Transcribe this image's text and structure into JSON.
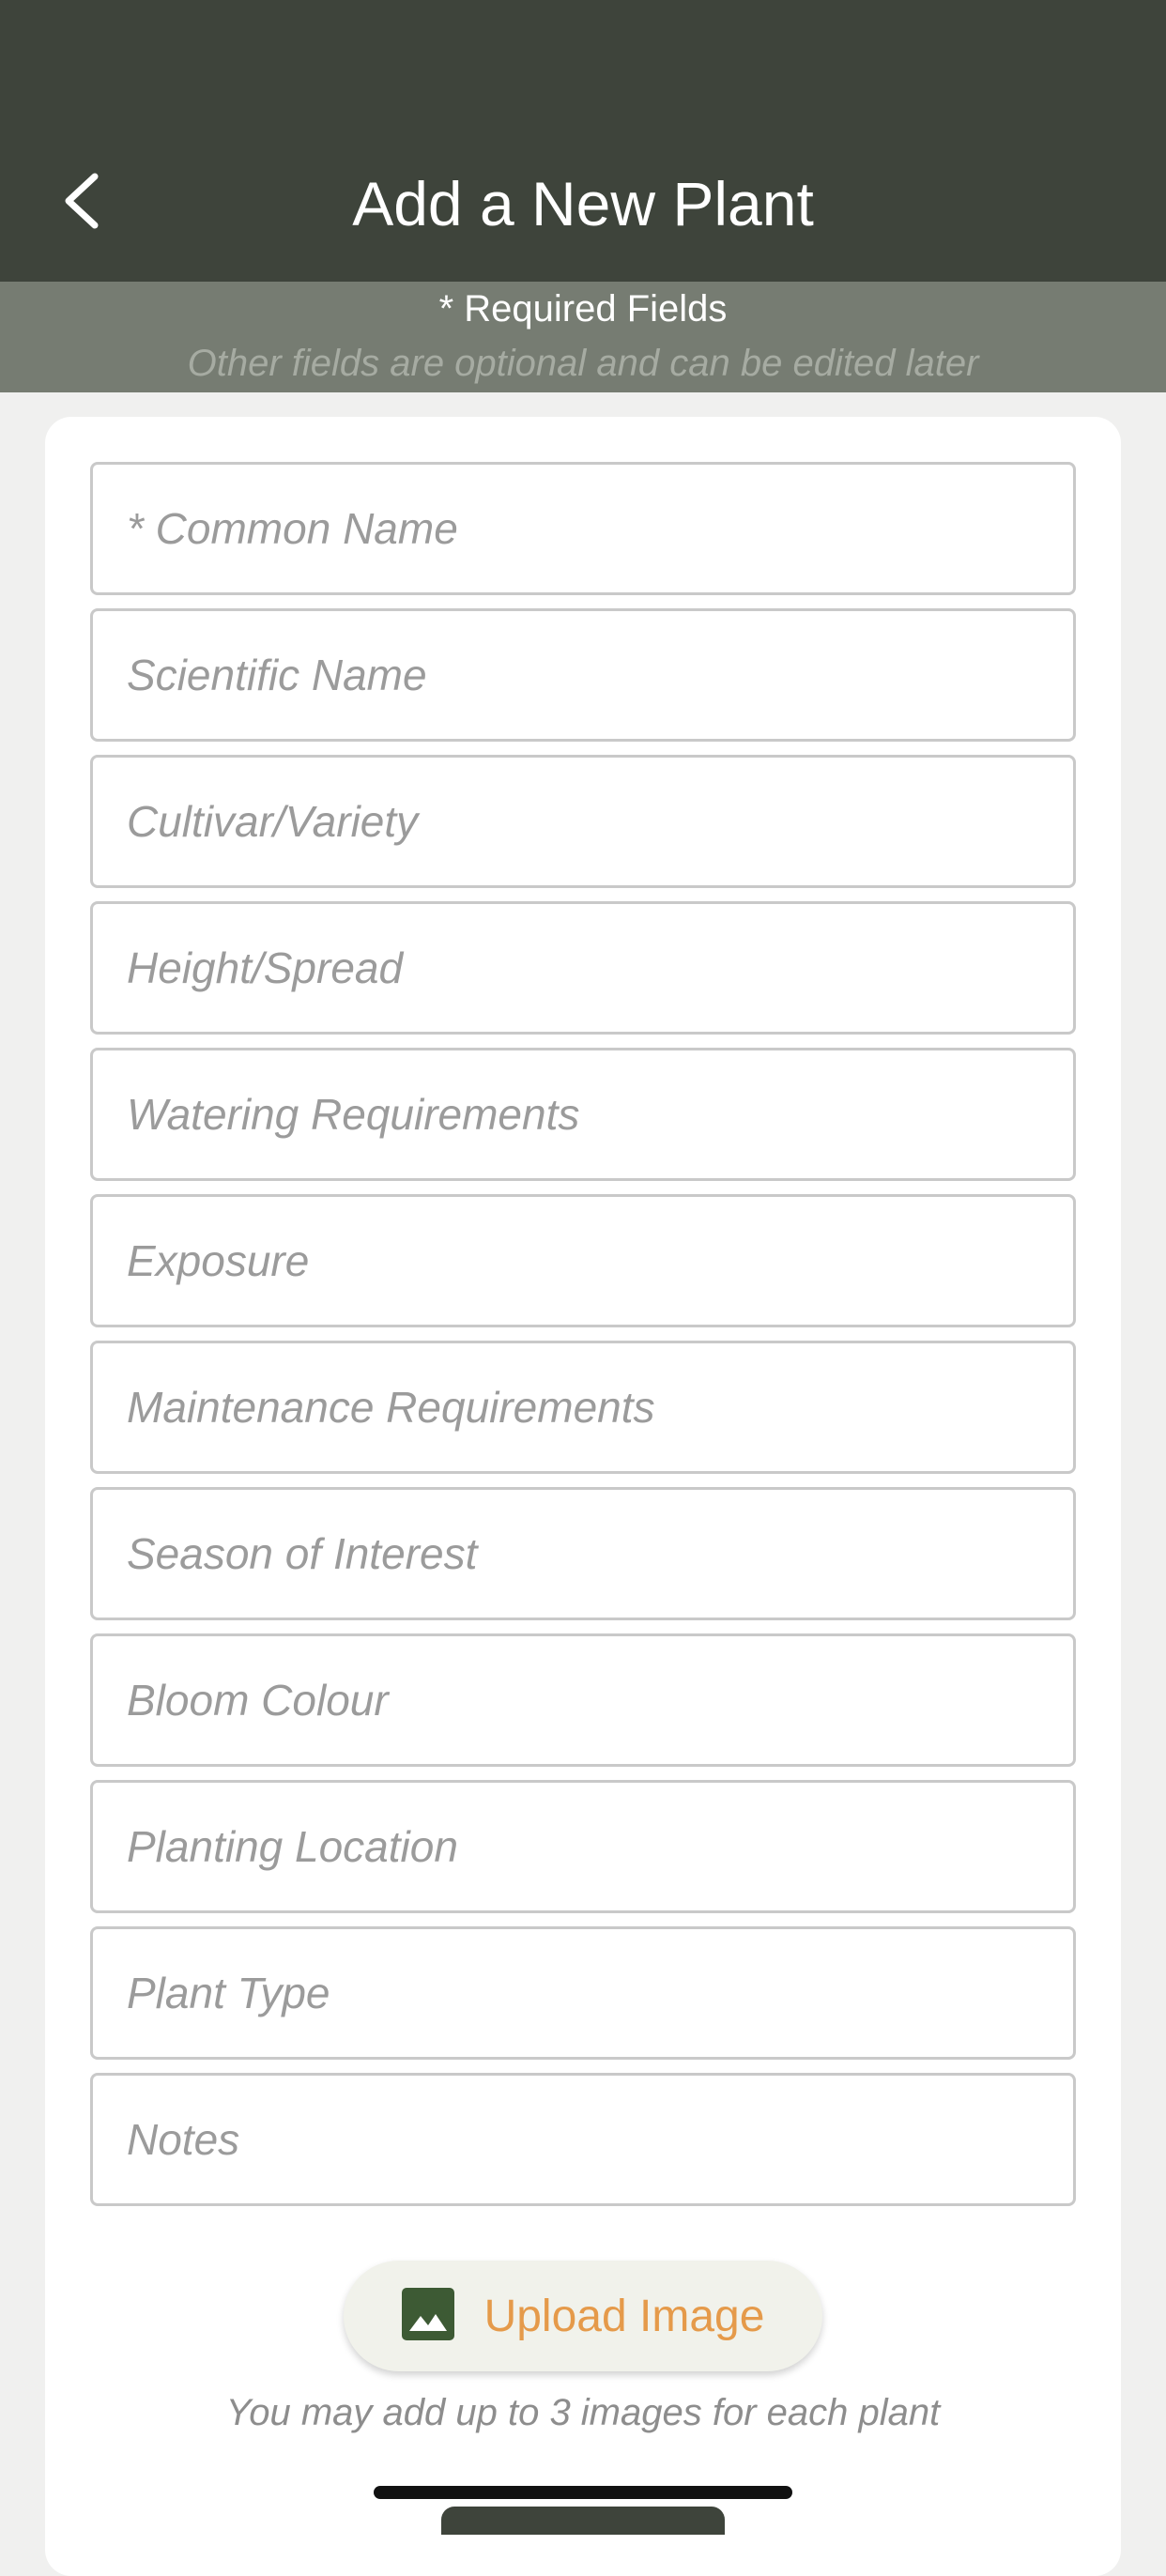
{
  "header": {
    "title": "Add a New Plant",
    "back_icon": "chevron-left-icon"
  },
  "notice": {
    "required": "* Required Fields",
    "optional_hint": "Other fields are optional and can be edited later"
  },
  "form": {
    "fields": [
      {
        "placeholder": "* Common Name",
        "value": ""
      },
      {
        "placeholder": "Scientific Name",
        "value": ""
      },
      {
        "placeholder": "Cultivar/Variety",
        "value": ""
      },
      {
        "placeholder": "Height/Spread",
        "value": ""
      },
      {
        "placeholder": "Watering Requirements",
        "value": ""
      },
      {
        "placeholder": "Exposure",
        "value": ""
      },
      {
        "placeholder": "Maintenance Requirements",
        "value": ""
      },
      {
        "placeholder": "Season of Interest",
        "value": ""
      },
      {
        "placeholder": "Bloom Colour",
        "value": ""
      },
      {
        "placeholder": "Planting Location",
        "value": ""
      },
      {
        "placeholder": "Plant Type",
        "value": ""
      },
      {
        "placeholder": "Notes",
        "value": ""
      }
    ]
  },
  "upload": {
    "label": "Upload Image",
    "icon": "image-icon",
    "note": "You may add up to 3 images for each plant"
  },
  "colors": {
    "header_bg": "#3e443b",
    "notice_bg": "#767c72",
    "accent_orange": "#e59a4a",
    "icon_green": "#3d5a34"
  }
}
